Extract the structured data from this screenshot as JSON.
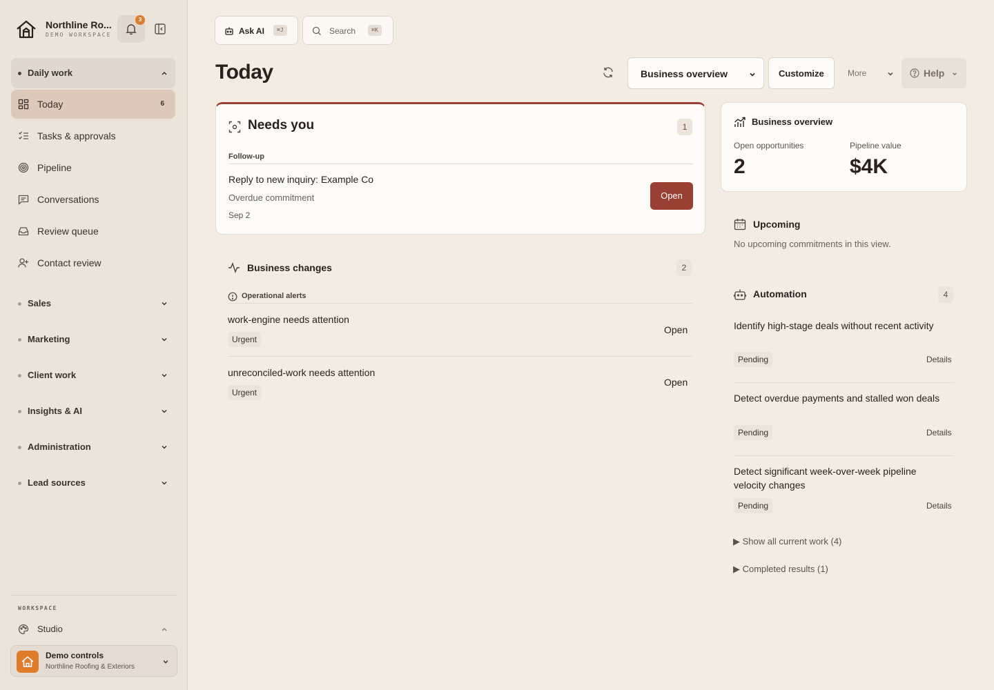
{
  "brand": {
    "name": "Northline Ro...",
    "subtitle": "DEMO WORKSPACE",
    "notifications": "3"
  },
  "sidebar": {
    "daily_work": "Daily work",
    "items": [
      {
        "label": "Today",
        "count": "6"
      },
      {
        "label": "Tasks & approvals"
      },
      {
        "label": "Pipeline"
      },
      {
        "label": "Conversations"
      },
      {
        "label": "Review queue"
      },
      {
        "label": "Contact review"
      }
    ],
    "groups": [
      "Sales",
      "Marketing",
      "Client work",
      "Insights & AI",
      "Administration",
      "Lead sources"
    ],
    "workspace_label": "WORKSPACE",
    "studio": "Studio",
    "demo_title": "Demo controls",
    "demo_sub": "Northline Roofing & Exteriors"
  },
  "topbar": {
    "ask_ai": "Ask AI",
    "ask_kbd": "⌘J",
    "search": "Search",
    "search_kbd": "⌘K"
  },
  "header": {
    "title": "Today",
    "view": "Business overview",
    "customize": "Customize",
    "more": "More",
    "help": "Help"
  },
  "needs_you": {
    "title": "Needs you",
    "count": "1",
    "section": "Follow-up",
    "item_title": "Reply to new inquiry: Example Co",
    "item_sub": "Overdue commitment",
    "item_date": "Sep 2",
    "action": "Open"
  },
  "changes": {
    "title": "Business changes",
    "count": "2",
    "section": "Operational alerts",
    "items": [
      {
        "title": "work-engine needs attention",
        "tag": "Urgent",
        "action": "Open"
      },
      {
        "title": "unreconciled-work needs attention",
        "tag": "Urgent",
        "action": "Open"
      }
    ]
  },
  "overview": {
    "title": "Business overview",
    "metrics": [
      {
        "label": "Open opportunities",
        "value": "2"
      },
      {
        "label": "Pipeline value",
        "value": "$4K"
      }
    ]
  },
  "upcoming": {
    "title": "Upcoming",
    "empty": "No upcoming commitments in this view."
  },
  "automation": {
    "title": "Automation",
    "count": "4",
    "items": [
      {
        "title": "Identify high-stage deals without recent activity",
        "status": "Pending",
        "action": "Details"
      },
      {
        "title": "Detect overdue payments and stalled won deals",
        "status": "Pending",
        "action": "Details"
      },
      {
        "title": "Detect significant week-over-week pipeline velocity changes",
        "status": "Pending",
        "action": "Details"
      }
    ],
    "show_all": "▶  Show all current work (4)",
    "completed": "▶  Completed results (1)"
  },
  "colors": {
    "accent": "#9a3f33",
    "brand_orange": "#e07b2a",
    "background": "#f3ece3",
    "sidebar": "#ebe4da"
  }
}
